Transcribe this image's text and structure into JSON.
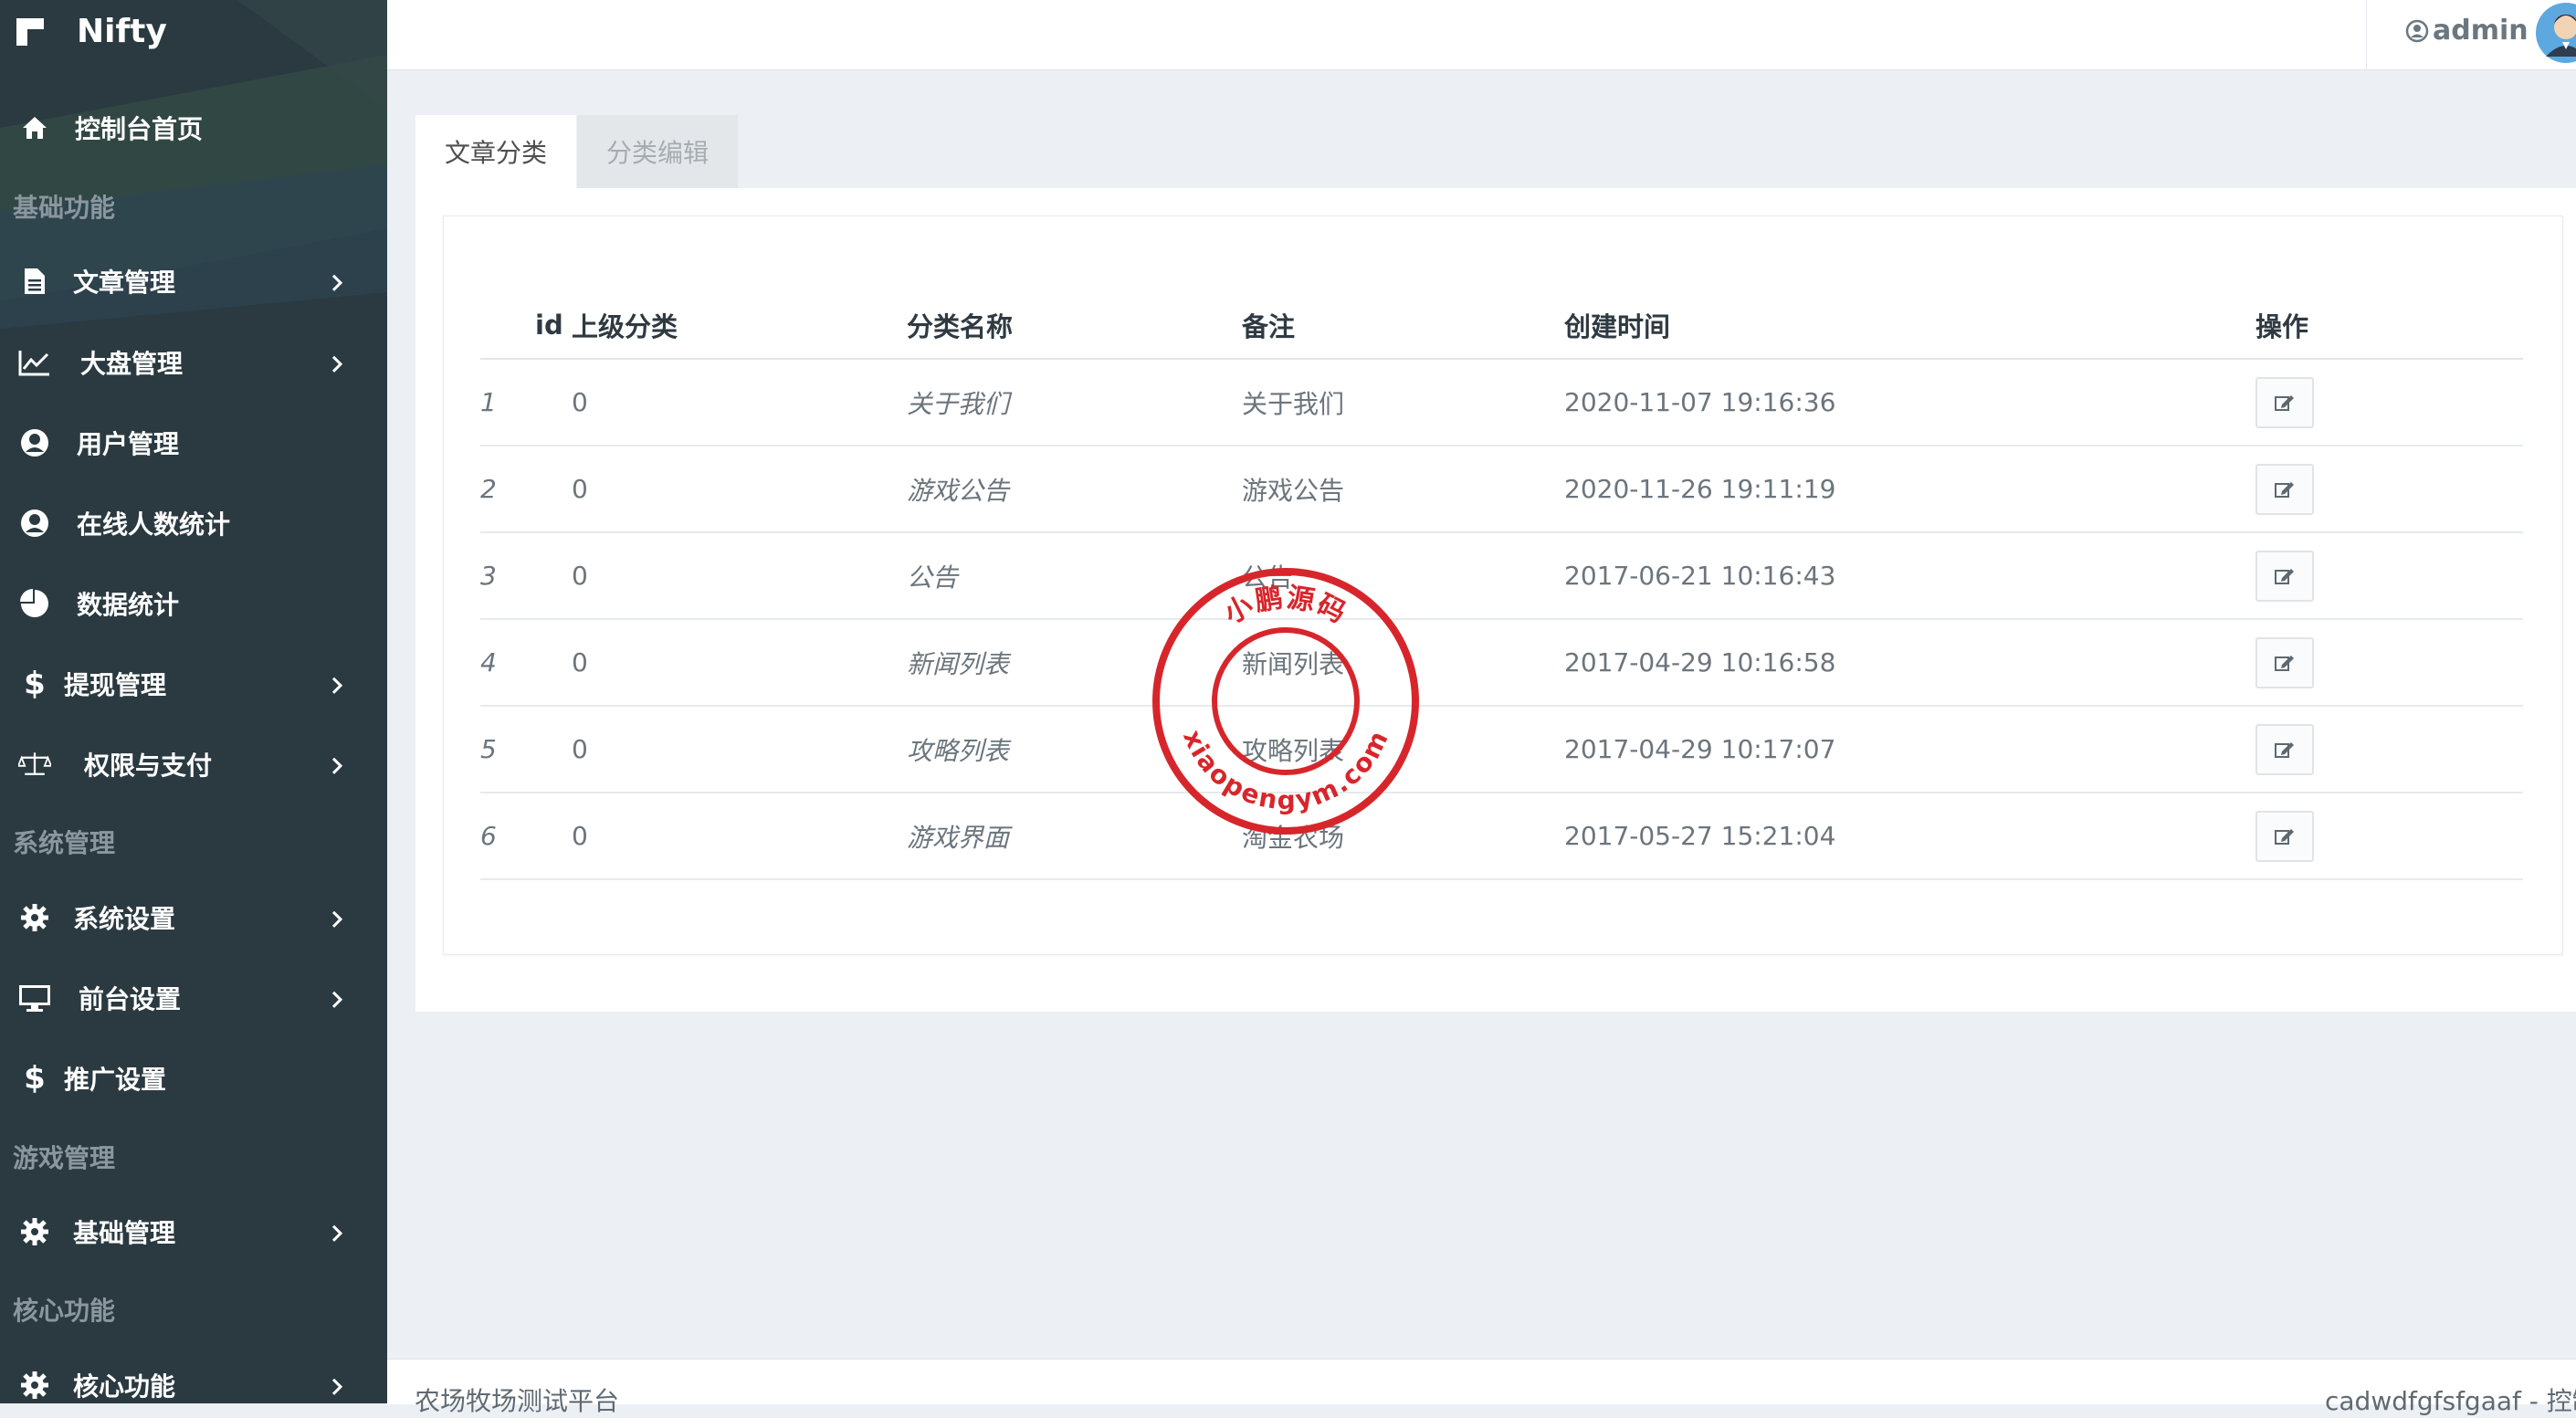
{
  "brand": {
    "title": "Nifty"
  },
  "sidebar": {
    "dashboard": {
      "label": "控制台首页",
      "icon": "home-icon"
    },
    "sections": [
      {
        "header": "基础功能",
        "items": [
          {
            "label": "文章管理",
            "icon": "file-icon",
            "has_submenu": true
          },
          {
            "label": "大盘管理",
            "icon": "line-chart-icon",
            "has_submenu": true
          },
          {
            "label": "用户管理",
            "icon": "user-circle-icon",
            "has_submenu": false
          },
          {
            "label": "在线人数统计",
            "icon": "user-circle-icon",
            "has_submenu": false
          },
          {
            "label": "数据统计",
            "icon": "pie-chart-icon",
            "has_submenu": false
          },
          {
            "label": "提现管理",
            "icon": "dollar-icon",
            "has_submenu": true
          },
          {
            "label": "权限与支付",
            "icon": "balance-scale-icon",
            "has_submenu": true
          }
        ]
      },
      {
        "header": "系统管理",
        "items": [
          {
            "label": "系统设置",
            "icon": "gear-icon",
            "has_submenu": true
          },
          {
            "label": "前台设置",
            "icon": "desktop-icon",
            "has_submenu": true
          },
          {
            "label": "推广设置",
            "icon": "dollar-icon",
            "has_submenu": false
          }
        ]
      },
      {
        "header": "游戏管理",
        "items": [
          {
            "label": "基础管理",
            "icon": "gear-icon",
            "has_submenu": true
          }
        ]
      },
      {
        "header": "核心功能",
        "items": [
          {
            "label": "核心功能",
            "icon": "gear-icon",
            "has_submenu": true
          }
        ]
      }
    ]
  },
  "topbar": {
    "username": "admin"
  },
  "tabs": [
    {
      "label": "文章分类",
      "active": true
    },
    {
      "label": "分类编辑",
      "active": false
    }
  ],
  "table": {
    "headers": {
      "id": "id",
      "parent": "上级分类",
      "name": "分类名称",
      "remark": "备注",
      "created": "创建时间",
      "action": "操作"
    },
    "rows": [
      {
        "id": "1",
        "parent": "0",
        "name": "关于我们",
        "remark": "关于我们",
        "created": "2020-11-07 19:16:36"
      },
      {
        "id": "2",
        "parent": "0",
        "name": "游戏公告",
        "remark": "游戏公告",
        "created": "2020-11-26 19:11:19"
      },
      {
        "id": "3",
        "parent": "0",
        "name": "公告",
        "remark": "公告",
        "created": "2017-06-21 10:16:43"
      },
      {
        "id": "4",
        "parent": "0",
        "name": "新闻列表",
        "remark": "新闻列表",
        "created": "2017-04-29 10:16:58"
      },
      {
        "id": "5",
        "parent": "0",
        "name": "攻略列表",
        "remark": "攻略列表",
        "created": "2017-04-29 10:17:07"
      },
      {
        "id": "6",
        "parent": "0",
        "name": "游戏界面",
        "remark": "淘金农场",
        "created": "2017-05-27 15:21:04"
      }
    ]
  },
  "stamp": {
    "top_text": "小鹏源码",
    "bottom_text": "xiaopengym.com"
  },
  "footer": {
    "left": "农场牧场测试平台",
    "right": "cadwdfgfsfgaaf - 控制"
  },
  "colors": {
    "sidebar_bg": "#2b3a41",
    "page_bg": "#ecf0f5",
    "stamp_red": "#d7262b"
  }
}
